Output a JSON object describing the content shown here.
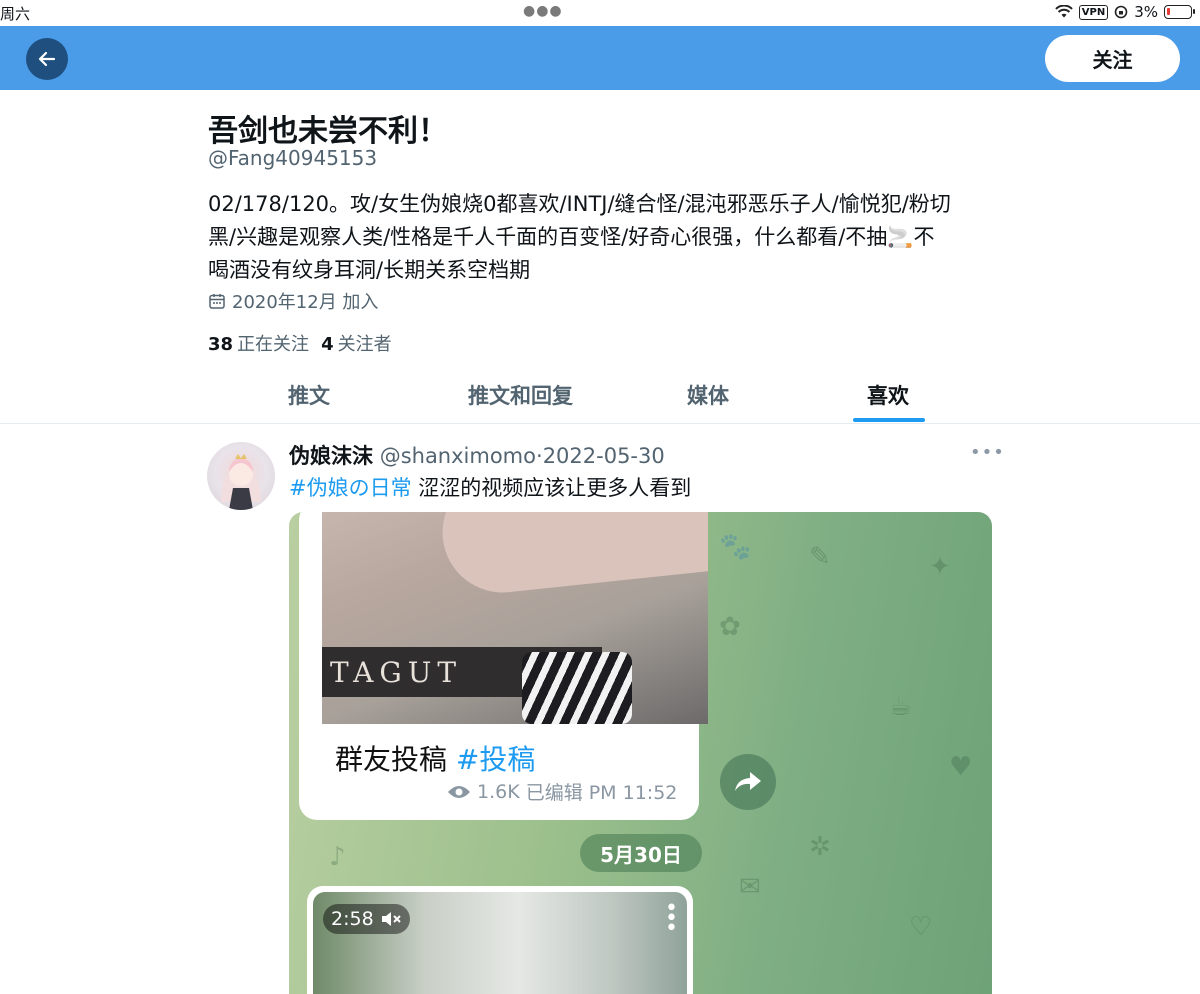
{
  "status_bar": {
    "day": "周六",
    "vpn": "VPN",
    "battery": "3%"
  },
  "header": {
    "follow_label": "关注"
  },
  "profile": {
    "name": "吾剑也未尝不利！",
    "handle": "@Fang40945153",
    "bio_line1": "02/178/120。攻/女生伪娘烧0都喜欢/INTJ/缝合怪/混沌邪恶乐子人/愉悦犯/粉切",
    "bio_line2": "黑/兴趣是观察人类/性格是千人千面的百变怪/好奇心很强，什么都看/不抽🚬不",
    "bio_line3": "喝酒没有纹身耳洞/长期关系空档期",
    "joined": "2020年12月 加入",
    "following_count": "38",
    "following_label": "正在关注",
    "followers_count": "4",
    "followers_label": "关注者"
  },
  "tabs": [
    {
      "label": "推文"
    },
    {
      "label": "推文和回复"
    },
    {
      "label": "媒体"
    },
    {
      "label": "喜欢",
      "active": true
    }
  ],
  "tweet": {
    "author": "伪娘沫沫",
    "handle": "@shanximomo",
    "separator": "·",
    "date": "2022-05-30",
    "hashtag": "#伪娘の日常",
    "text": " 涩涩的视频应该让更多人看到",
    "media": {
      "book_text": "TAGUT",
      "caption": "群友投稿",
      "caption_tag": "#投稿",
      "views": "1.6K",
      "edited_time": "已编辑 PM 11:52",
      "date_pill": "5月30日",
      "video_duration": "2:58"
    }
  }
}
